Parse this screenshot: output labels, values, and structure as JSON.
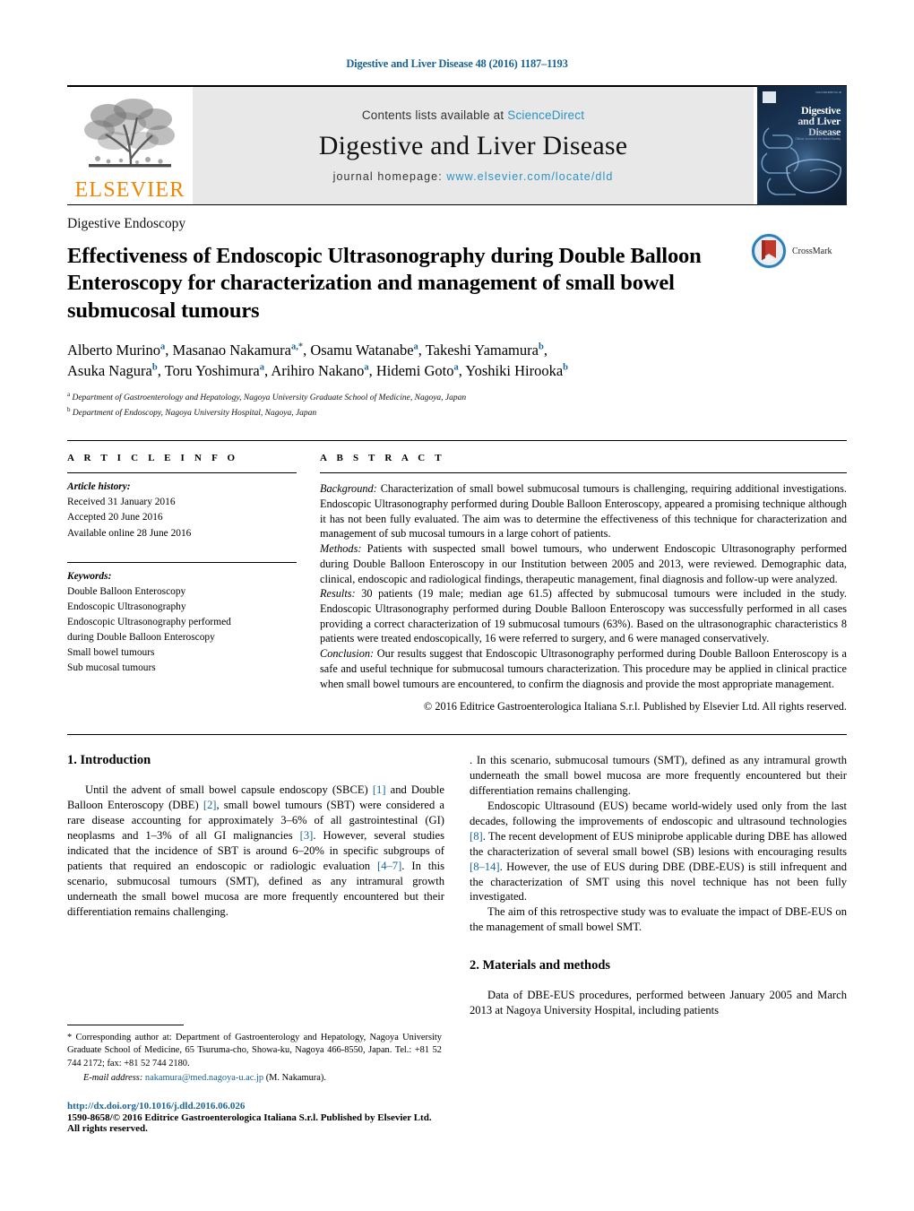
{
  "running_head": "Digestive and Liver Disease 48 (2016) 1187–1193",
  "masthead": {
    "publisher_name": "ELSEVIER",
    "contents_prefix": "Contents lists available at",
    "contents_link": "ScienceDirect",
    "journal_title": "Digestive and Liver Disease",
    "homepage_prefix": "journal homepage:",
    "homepage_url": "www.elsevier.com/locate/dld",
    "cover": {
      "title_line1": "Digestive",
      "title_line2": "and Liver",
      "title_line3": "Disease",
      "subtitle": "Official Journal of the Italian Society",
      "corner_meta": "ISSN 1590-8658 VOL 48"
    }
  },
  "article": {
    "subject": "Digestive Endoscopy",
    "title": "Effectiveness of Endoscopic Ultrasonography during Double Balloon Enteroscopy for characterization and management of small bowel submucosal tumours",
    "authors_line1": "Alberto Murino",
    "authors": [
      {
        "name": "Alberto Murino",
        "sup": "a"
      },
      {
        "name": "Masanao Nakamura",
        "sup": "a,*"
      },
      {
        "name": "Osamu Watanabe",
        "sup": "a"
      },
      {
        "name": "Takeshi Yamamura",
        "sup": "b"
      },
      {
        "name": "Asuka Nagura",
        "sup": "b"
      },
      {
        "name": "Toru Yoshimura",
        "sup": "a"
      },
      {
        "name": "Arihiro Nakano",
        "sup": "a"
      },
      {
        "name": "Hidemi Goto",
        "sup": "a"
      },
      {
        "name": "Yoshiki Hirooka",
        "sup": "b"
      }
    ],
    "affiliations": [
      {
        "sup": "a",
        "text": "Department of Gastroenterology and Hepatology, Nagoya University Graduate School of Medicine, Nagoya, Japan"
      },
      {
        "sup": "b",
        "text": "Department of Endoscopy, Nagoya University Hospital, Nagoya, Japan"
      }
    ],
    "crossmark_label": "CrossMark"
  },
  "info": {
    "heading": "A R T I C L E   I N F O",
    "history_label": "Article history:",
    "history": [
      "Received 31 January 2016",
      "Accepted 20 June 2016",
      "Available online 28 June 2016"
    ],
    "keywords_label": "Keywords:",
    "keywords": [
      "Double Balloon Enteroscopy",
      "Endoscopic Ultrasonography",
      "Endoscopic Ultrasonography performed",
      "during Double Balloon Enteroscopy",
      "Small bowel tumours",
      "Sub mucosal tumours"
    ]
  },
  "abstract": {
    "heading": "A B S T R A C T",
    "background_label": "Background:",
    "background_text": " Characterization of small bowel submucosal tumours is challenging, requiring additional investigations. Endoscopic Ultrasonography performed during Double Balloon Enteroscopy, appeared a promising technique although it has not been fully evaluated. The aim was to determine the effectiveness of this technique for characterization and management of sub mucosal tumours in a large cohort of patients.",
    "methods_label": "Methods:",
    "methods_text": " Patients with suspected small bowel tumours, who underwent Endoscopic Ultrasonography performed during Double Balloon Enteroscopy in our Institution between 2005 and 2013, were reviewed. Demographic data, clinical, endoscopic and radiological findings, therapeutic management, final diagnosis and follow-up were analyzed.",
    "results_label": "Results:",
    "results_text": " 30 patients (19 male; median age 61.5) affected by submucosal tumours were included in the study. Endoscopic Ultrasonography performed during Double Balloon Enteroscopy was successfully performed in all cases providing a correct characterization of 19 submucosal tumours (63%). Based on the ultrasonographic characteristics 8 patients were treated endoscopically, 16 were referred to surgery, and 6 were managed conservatively.",
    "conclusion_label": "Conclusion:",
    "conclusion_text": " Our results suggest that Endoscopic Ultrasonography performed during Double Balloon Enteroscopy is a safe and useful technique for submucosal tumours characterization. This procedure may be applied in clinical practice when small bowel tumours are encountered, to confirm the diagnosis and provide the most appropriate management.",
    "copyright": "© 2016 Editrice Gastroenterologica Italiana S.r.l. Published by Elsevier Ltd. All rights reserved."
  },
  "body": {
    "intro_heading": "1.  Introduction",
    "intro_p1_a": "Until the advent of small bowel capsule endoscopy (SBCE) ",
    "intro_ref1": "[1]",
    "intro_p1_b": " and Double Balloon Enteroscopy (DBE) ",
    "intro_ref2": "[2]",
    "intro_p1_c": ", small bowel tumours (SBT) were considered a rare disease accounting for approximately 3–6% of all gastrointestinal (GI) neoplasms and 1–3% of all GI malignancies ",
    "intro_ref3": "[3]",
    "intro_p1_d": ". However, several studies indicated that the incidence of SBT is around 6–20% in specific subgroups of patients that required an endoscopic or radiologic evaluation ",
    "intro_ref4": "[4–7]",
    "intro_p1_e": ". In this scenario, submucosal tumours (SMT), defined as any intramural growth underneath the small bowel mucosa are more frequently encountered but their differentiation remains challenging.",
    "right_p1_a": "Endoscopic Ultrasound (EUS) became world-widely used only from the last decades, following the improvements of endoscopic and ultrasound technologies ",
    "right_ref8": "[8]",
    "right_p1_b": ". The recent development of EUS miniprobe applicable during DBE has allowed the characterization of several small bowel (SB) lesions with encouraging results ",
    "right_ref814": "[8–14]",
    "right_p1_c": ". However, the use of EUS during DBE (DBE-EUS) is still infrequent and the characterization of SMT using this novel technique has not been fully investigated.",
    "right_p2": "The aim of this retrospective study was to evaluate the impact of DBE-EUS on the management of small bowel SMT.",
    "methods_heading": "2.  Materials and methods",
    "methods_p1": "Data of DBE-EUS procedures, performed between January 2005 and March 2013 at Nagoya University Hospital, including patients"
  },
  "footer": {
    "corresponding_star": "*",
    "corresponding_text": "  Corresponding author at: Department of Gastroenterology and Hepatology, Nagoya University Graduate School of Medicine, 65 Tsuruma-cho, Showa-ku, Nagoya 466-8550, Japan. Tel.: +81 52 744 2172; fax: +81 52 744 2180.",
    "email_label": "E-mail address:",
    "email": "nakamura@med.nagoya-u.ac.jp",
    "email_owner": "(M. Nakamura).",
    "doi": "http://dx.doi.org/10.1016/j.dld.2016.06.026",
    "issn_line": "1590-8658/© 2016 Editrice Gastroenterologica Italiana S.r.l. Published by Elsevier Ltd. All rights reserved."
  },
  "colors": {
    "link": "#1a6496",
    "sciencedirect": "#2b93c4",
    "elsevier_orange": "#f08500",
    "band_gray": "#e8e8e8"
  }
}
